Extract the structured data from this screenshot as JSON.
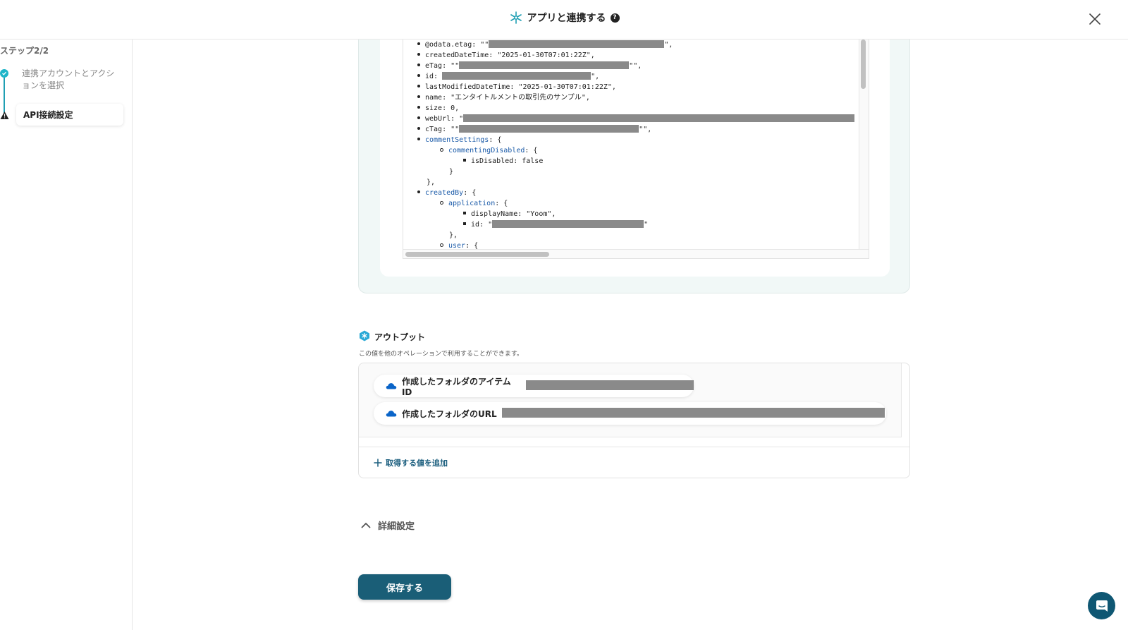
{
  "header": {
    "title": "アプリと連携する",
    "logo_icon": "yoom-asterisk-icon",
    "help_icon": "question-circle-icon",
    "close_icon": "close-icon"
  },
  "sidebar": {
    "step_count": "ステップ2/2",
    "steps": [
      {
        "label": "連携アカウントとアクションを選択",
        "status": "complete",
        "icon": "check-circle-icon"
      },
      {
        "label": "API接続設定",
        "status": "warning",
        "icon": "warning-icon",
        "active": true
      }
    ]
  },
  "json_preview": {
    "lines": [
      {
        "prefix": "@odata.etag: \"\"",
        "suffix": "\","
      },
      {
        "text": "createdDateTime: \"2025-01-30T07:01:22Z\","
      },
      {
        "prefix": "eTag: \"\"",
        "suffix": "\"\","
      },
      {
        "prefix": "id: ",
        "suffix": "\","
      },
      {
        "text": "lastModifiedDateTime: \"2025-01-30T07:01:22Z\","
      },
      {
        "text": "name: \"エンタイトルメントの取引先のサンプル\","
      },
      {
        "text": "size: 0,"
      },
      {
        "prefix": "webUrl: \"",
        "suffix": ""
      },
      {
        "prefix": "cTag: \"\"",
        "suffix": "\"\","
      },
      {
        "key": "commentSettings",
        "after": ": {"
      },
      {
        "key": "commentingDisabled",
        "after": ": {"
      },
      {
        "text": "isDisabled: false"
      },
      {
        "text": "}"
      },
      {
        "text": "},"
      },
      {
        "key": "createdBy",
        "after": ": {"
      },
      {
        "key": "application",
        "after": ": {"
      },
      {
        "text": "displayName: \"Yoom\","
      },
      {
        "prefix": "id: \"",
        "suffix": "\""
      },
      {
        "text": "},"
      },
      {
        "key": "user",
        "after": ": {"
      }
    ]
  },
  "output": {
    "title": "アウトプット",
    "description": "この値を他のオペレーションで利用することができます。",
    "items": [
      {
        "label": "作成したフォルダのアイテムID",
        "icon": "onedrive-cloud-icon"
      },
      {
        "label": "作成したフォルダのURL",
        "icon": "onedrive-cloud-icon"
      }
    ],
    "add_label": "取得する値を追加"
  },
  "details": {
    "label": "詳細設定",
    "icon": "chevron-up-icon"
  },
  "save": {
    "label": "保存する"
  },
  "colors": {
    "primary": "#1a5e77",
    "accent": "#1fb5c8",
    "panel_bg": "#f1f8f7",
    "redaction": "#8a8a8a"
  }
}
